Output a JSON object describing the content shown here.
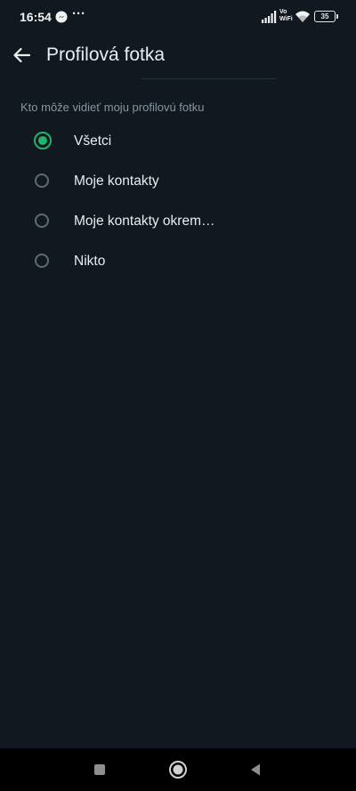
{
  "status_bar": {
    "time": "16:54",
    "more": "···",
    "vowifi_line1": "Vo",
    "vowifi_line2": "WiFi",
    "battery": "35"
  },
  "header": {
    "title": "Profilová fotka"
  },
  "section": {
    "label": "Kto môže vidieť moju profilovú fotku"
  },
  "options": [
    {
      "label": "Všetci",
      "selected": true
    },
    {
      "label": "Moje kontakty",
      "selected": false
    },
    {
      "label": "Moje kontakty okrem…",
      "selected": false
    },
    {
      "label": "Nikto",
      "selected": false
    }
  ],
  "colors": {
    "background": "#111820",
    "accent": "#1fb36b",
    "secondary_text": "#8696a0",
    "primary_text": "#e9edef"
  }
}
